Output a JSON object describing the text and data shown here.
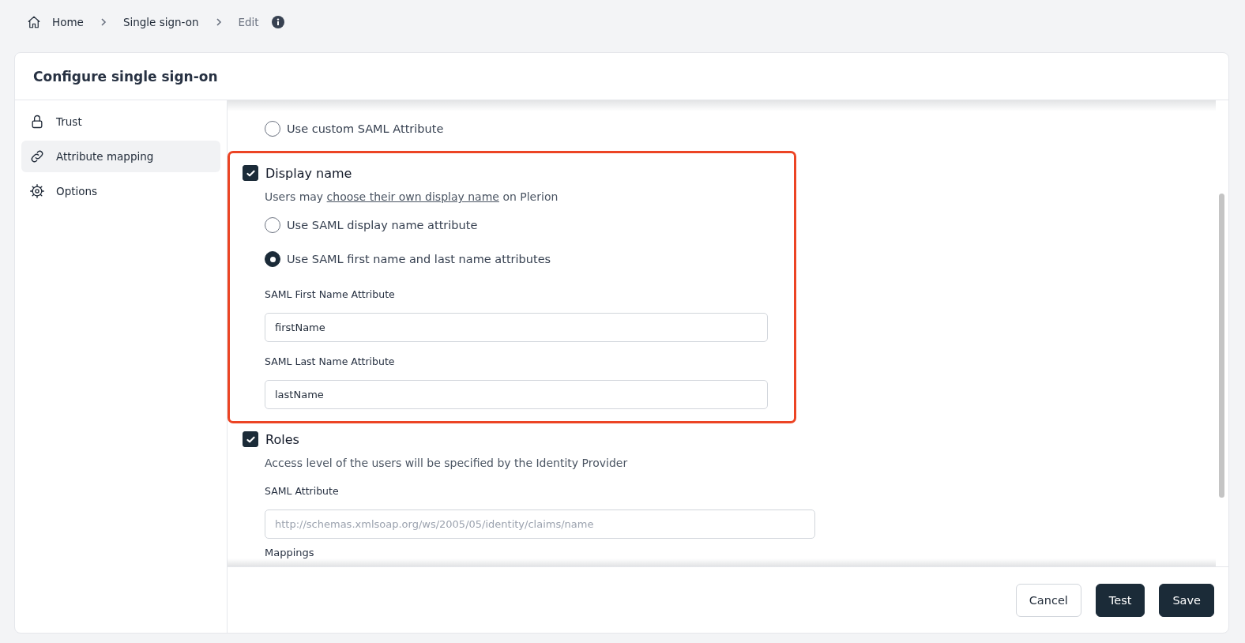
{
  "breadcrumb": [
    {
      "label": "Home",
      "kind": "home"
    },
    {
      "label": "Single sign-on",
      "kind": "link"
    },
    {
      "label": "Edit",
      "kind": "current"
    }
  ],
  "page": {
    "title": "Configure single sign-on"
  },
  "sidebar": {
    "items": [
      {
        "label": "Trust",
        "selected": false
      },
      {
        "label": "Attribute mapping",
        "selected": true
      },
      {
        "label": "Options",
        "selected": false
      }
    ]
  },
  "sections": [
    {
      "kind": "radio-group",
      "highlighted": false,
      "options": [
        {
          "label": "Use custom SAML Attribute",
          "selected": false
        }
      ]
    },
    {
      "kind": "checkbox-section",
      "highlighted": true,
      "label": "Display name",
      "checked": true,
      "description": {
        "before": "Users may ",
        "link": "choose their own display name",
        "after": " on Plerion"
      },
      "options": [
        {
          "label": "Use SAML display name attribute",
          "selected": false
        },
        {
          "label": "Use SAML first name and last name attributes",
          "selected": true
        }
      ],
      "fields": [
        {
          "label": "SAML First Name Attribute",
          "value": "firstName"
        },
        {
          "label": "SAML Last Name Attribute",
          "value": "lastName"
        }
      ]
    },
    {
      "kind": "checkbox-section",
      "highlighted": false,
      "label": "Roles",
      "checked": true,
      "description": {
        "before": "Access level of the users will be specified by the Identity Provider"
      },
      "fields": [
        {
          "label": "SAML Attribute",
          "placeholder": "http://schemas.xmlsoap.org/ws/2005/05/identity/claims/name",
          "wide": true
        }
      ],
      "subheading": "Mappings"
    }
  ],
  "footer": {
    "buttons": [
      {
        "label": "Cancel",
        "kind": "secondary"
      },
      {
        "label": "Test",
        "kind": "primary"
      },
      {
        "label": "Save",
        "kind": "primary"
      }
    ]
  }
}
